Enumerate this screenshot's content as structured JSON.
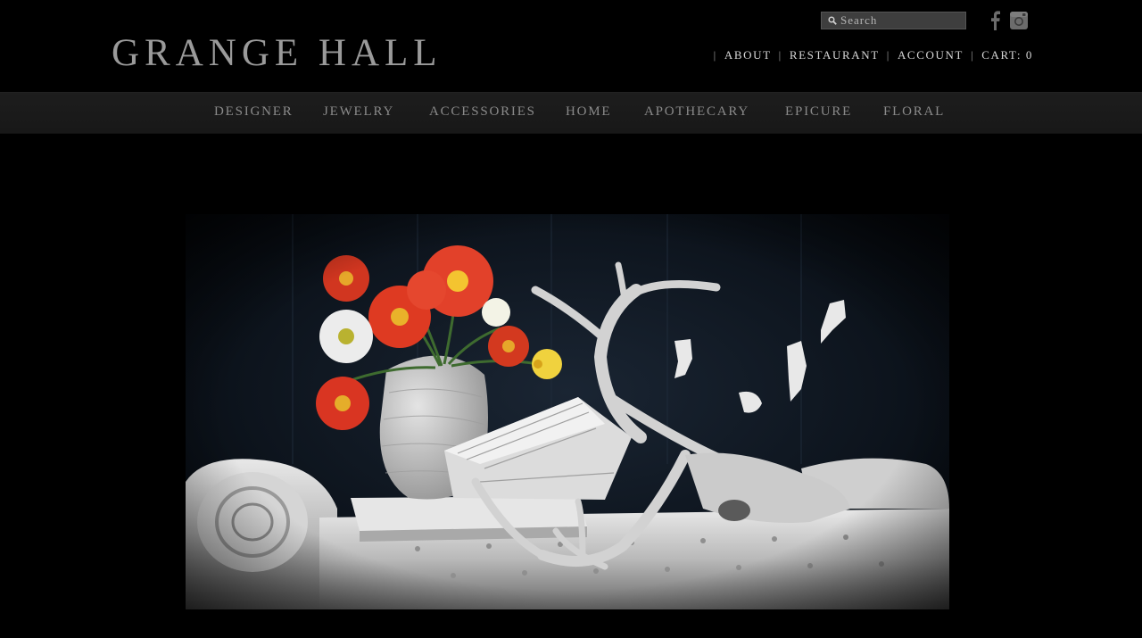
{
  "brand": {
    "name": "GRANGE HALL"
  },
  "search": {
    "placeholder": "Search"
  },
  "social": {
    "facebook_icon": "facebook-icon",
    "instagram_icon": "instagram-icon"
  },
  "utility_nav": {
    "separator": "|",
    "items": [
      {
        "label": "ABOUT"
      },
      {
        "label": "RESTAURANT"
      },
      {
        "label": "ACCOUNT"
      },
      {
        "label": "CART: 0"
      }
    ]
  },
  "categories": [
    {
      "label": "DESIGNER"
    },
    {
      "label": "JEWELRY"
    },
    {
      "label": "ACCESSORIES"
    },
    {
      "label": "HOME"
    },
    {
      "label": "APOTHECARY"
    },
    {
      "label": "EPICURE"
    },
    {
      "label": "FLORAL"
    }
  ],
  "colors": {
    "background": "#000000",
    "category_bar": "#1b1b1b",
    "logo_text": "#9a9a9a",
    "poppy_red": "#e2412a"
  }
}
